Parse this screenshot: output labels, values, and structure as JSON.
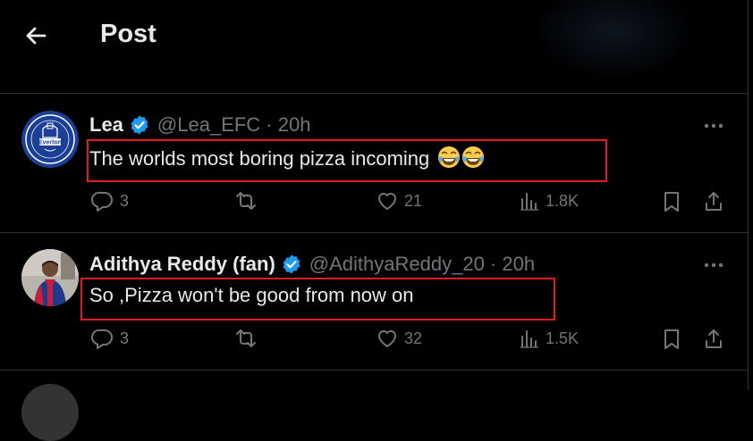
{
  "header": {
    "title": "Post"
  },
  "posts": [
    {
      "name": "Lea",
      "handle": "@Lea_EFC · 20h",
      "text": "The worlds most boring pizza incoming",
      "emoji": "😂😂",
      "avatar_text": "Everton",
      "replies": "3",
      "reposts": "",
      "likes": "21",
      "views": "1.8K"
    },
    {
      "name": "Adithya Reddy (fan)",
      "handle": "@AdithyaReddy_20 · 20h",
      "text": "So ,Pizza won't be good from now on",
      "replies": "3",
      "reposts": "",
      "likes": "32",
      "views": "1.5K"
    }
  ],
  "colors": {
    "verified": "#1d9bf0",
    "highlight": "#e11b22",
    "muted": "#71767b",
    "everton_blue": "#1b3f94"
  },
  "icons": [
    "back-arrow-icon",
    "verified-badge-icon",
    "more-icon",
    "reply-icon",
    "repost-icon",
    "like-icon",
    "views-icon",
    "bookmark-icon",
    "share-icon"
  ]
}
